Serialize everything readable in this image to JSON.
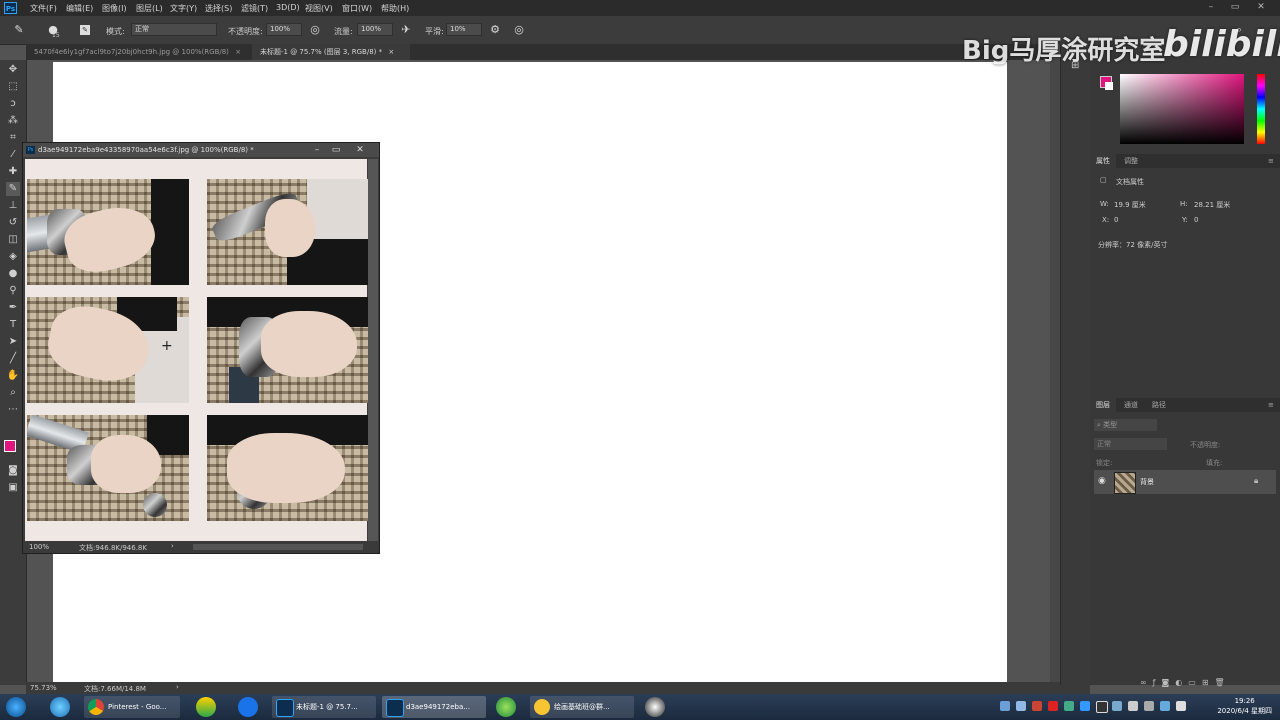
{
  "menubar": {
    "logo": "Ps",
    "items": [
      "文件(F)",
      "编辑(E)",
      "图像(I)",
      "图层(L)",
      "文字(Y)",
      "选择(S)",
      "滤镜(T)",
      "3D(D)",
      "视图(V)",
      "窗口(W)",
      "帮助(H)"
    ]
  },
  "options": {
    "brush_size": "15",
    "mode_label": "模式:",
    "mode_value": "正常",
    "opacity_label": "不透明度:",
    "opacity_value": "100%",
    "flow_label": "流量:",
    "flow_value": "100%",
    "smooth_label": "平滑:",
    "smooth_value": "10%"
  },
  "tabs": [
    {
      "label": "5470f4e6ly1gf7acl9to7j20bj0hct9h.jpg @ 100%(RGB/8)"
    },
    {
      "label": "未标题-1 @ 75.7% (图层 3, RGB/8) *"
    }
  ],
  "float_window": {
    "title": "d3ae949172eba9e43358970aa54e6c3f.jpg @ 100%(RGB/8) *",
    "zoom": "100%",
    "doc_info": "文档:946.8K/946.8K"
  },
  "status": {
    "zoom": "75.73%",
    "doc_info": "文档:7.66M/14.8M"
  },
  "panels": {
    "properties_tab": "属性",
    "adjust_tab": "调整",
    "doc_props": "文档属性",
    "w_label": "W:",
    "w_value": "19.9 厘米",
    "h_label": "H:",
    "h_value": "28.21 厘米",
    "x_label": "X:",
    "x_value": "0",
    "y_label": "Y:",
    "y_value": "0",
    "resolution": "分辨率：72 像素/英寸",
    "layers_tab": "图层",
    "channels_tab": "通道",
    "paths_tab": "路径",
    "layer_kind": "类型",
    "blend_mode": "正常",
    "layer_opacity": "不透明度:",
    "lock_label": "锁定:",
    "fill_label": "填充:",
    "layer_name": "背景"
  },
  "watermark": {
    "text": "Big马厚涂研究室",
    "logo": "bilibili"
  },
  "taskbar": {
    "items": [
      {
        "label": "Pinterest - Goo..."
      },
      {
        "label": "未标题-1 @ 75.7..."
      },
      {
        "label": "d3ae949172eba..."
      },
      {
        "label": "绘画基础班@群..."
      }
    ],
    "time": "19:26",
    "date": "2020/6/4 星期四"
  },
  "colors": {
    "foreground": "#e0157e",
    "background": "#ffffff",
    "ps_blue": "#2fa3f7"
  }
}
